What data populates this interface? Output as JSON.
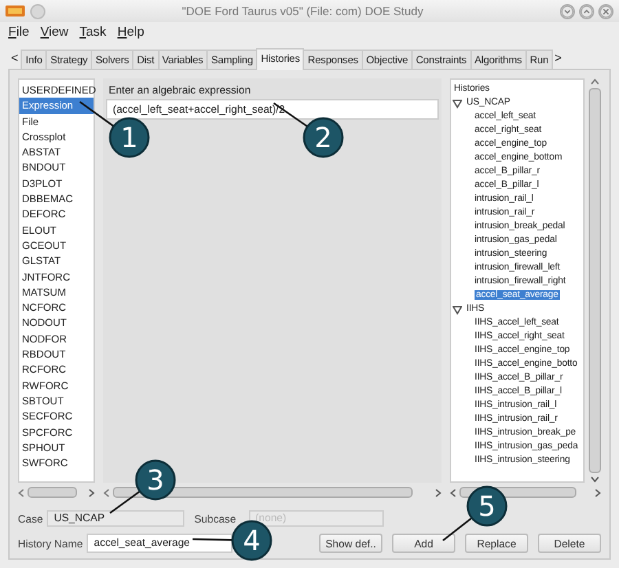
{
  "window": {
    "title": "\"DOE Ford Taurus v05\" (File: com)  DOE Study"
  },
  "menu": [
    "File",
    "View",
    "Task",
    "Help"
  ],
  "tab_scroll": {
    "left": "<",
    "right": ">"
  },
  "tabs": [
    {
      "label": "Info",
      "selected": false
    },
    {
      "label": "Strategy",
      "selected": false
    },
    {
      "label": "Solvers",
      "selected": false
    },
    {
      "label": "Dist",
      "selected": false
    },
    {
      "label": "Variables",
      "selected": false
    },
    {
      "label": "Sampling",
      "selected": false
    },
    {
      "label": "Histories",
      "selected": true
    },
    {
      "label": "Responses",
      "selected": false
    },
    {
      "label": "Objective",
      "selected": false
    },
    {
      "label": "Constraints",
      "selected": false
    },
    {
      "label": "Algorithms",
      "selected": false
    },
    {
      "label": "Run",
      "selected": false
    }
  ],
  "sources": [
    {
      "label": "USERDEFINED",
      "selected": false
    },
    {
      "label": "Expression",
      "selected": true
    },
    {
      "label": "File",
      "selected": false
    },
    {
      "label": "Crossplot",
      "selected": false
    },
    {
      "label": "ABSTAT",
      "selected": false
    },
    {
      "label": "BNDOUT",
      "selected": false
    },
    {
      "label": "D3PLOT",
      "selected": false
    },
    {
      "label": "DBBEMAC",
      "selected": false
    },
    {
      "label": "DEFORC",
      "selected": false
    },
    {
      "label": "ELOUT",
      "selected": false
    },
    {
      "label": "GCEOUT",
      "selected": false
    },
    {
      "label": "GLSTAT",
      "selected": false
    },
    {
      "label": "JNTFORC",
      "selected": false
    },
    {
      "label": "MATSUM",
      "selected": false
    },
    {
      "label": "NCFORC",
      "selected": false
    },
    {
      "label": "NODOUT",
      "selected": false
    },
    {
      "label": "NODFOR",
      "selected": false
    },
    {
      "label": "RBDOUT",
      "selected": false
    },
    {
      "label": "RCFORC",
      "selected": false
    },
    {
      "label": "RWFORC",
      "selected": false
    },
    {
      "label": "SBTOUT",
      "selected": false
    },
    {
      "label": "SECFORC",
      "selected": false
    },
    {
      "label": "SPCFORC",
      "selected": false
    },
    {
      "label": "SPHOUT",
      "selected": false
    },
    {
      "label": "SWFORC",
      "selected": false
    }
  ],
  "expression": {
    "label": "Enter an algebraic expression",
    "value": "(accel_left_seat+accel_right_seat)/2"
  },
  "histories": {
    "title": "Histories",
    "groups": [
      {
        "label": "US_NCAP",
        "expanded": true,
        "children": [
          {
            "label": "accel_left_seat",
            "selected": false
          },
          {
            "label": "accel_right_seat",
            "selected": false
          },
          {
            "label": "accel_engine_top",
            "selected": false
          },
          {
            "label": "accel_engine_bottom",
            "selected": false
          },
          {
            "label": "accel_B_pillar_r",
            "selected": false
          },
          {
            "label": "accel_B_pillar_l",
            "selected": false
          },
          {
            "label": "intrusion_rail_l",
            "selected": false
          },
          {
            "label": "intrusion_rail_r",
            "selected": false
          },
          {
            "label": "intrusion_break_pedal",
            "selected": false
          },
          {
            "label": "intrusion_gas_pedal",
            "selected": false
          },
          {
            "label": "intrusion_steering",
            "selected": false
          },
          {
            "label": "intrusion_firewall_left",
            "selected": false
          },
          {
            "label": "intrusion_firewall_right",
            "selected": false
          },
          {
            "label": "accel_seat_average",
            "selected": true
          }
        ]
      },
      {
        "label": "IIHS",
        "expanded": true,
        "children": [
          {
            "label": "IIHS_accel_left_seat",
            "selected": false
          },
          {
            "label": "IIHS_accel_right_seat",
            "selected": false
          },
          {
            "label": "IIHS_accel_engine_top",
            "selected": false
          },
          {
            "label": "IIHS_accel_engine_botto",
            "selected": false
          },
          {
            "label": "IIHS_accel_B_pillar_r",
            "selected": false
          },
          {
            "label": "IIHS_accel_B_pillar_l",
            "selected": false
          },
          {
            "label": "IIHS_intrusion_rail_l",
            "selected": false
          },
          {
            "label": "IIHS_intrusion_rail_r",
            "selected": false
          },
          {
            "label": "IIHS_intrusion_break_pe",
            "selected": false
          },
          {
            "label": "IIHS_intrusion_gas_peda",
            "selected": false
          },
          {
            "label": "IIHS_intrusion_steering",
            "selected": false
          }
        ]
      }
    ]
  },
  "case": {
    "label": "Case",
    "value": "US_NCAP"
  },
  "subcase": {
    "label": "Subcase",
    "value": "(none)",
    "disabled": true
  },
  "history_name": {
    "label": "History Name",
    "value": "accel_seat_average"
  },
  "buttons": [
    "Show def..",
    "Add",
    "Replace",
    "Delete"
  ],
  "callouts": [
    "1",
    "2",
    "3",
    "4",
    "5"
  ]
}
